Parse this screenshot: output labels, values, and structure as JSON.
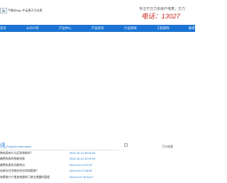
{
  "header": {
    "logo_text": "气象站logo 中云意万力仪表",
    "slogan": "专注于万力多用户电表，万力",
    "phone_label": "电话：",
    "phone_number": "13027"
  },
  "nav": {
    "items": [
      {
        "label": "首页"
      },
      {
        "label": "公司介绍"
      },
      {
        "label": "产品中心"
      },
      {
        "label": "产品资讯"
      },
      {
        "label": "行业新闻"
      },
      {
        "label": "工程案例"
      },
      {
        "label": "联系"
      }
    ]
  },
  "news": {
    "title": "讯",
    "subtitle": "Products information",
    "rows": [
      {
        "title": "物电表有什么区别和联系？",
        "date": "2024-10-14 18:16:18"
      },
      {
        "title": "缴费电表的智能电表",
        "date": "2024-10-14 12:09:04"
      },
      {
        "title": "缴费电表的功能特点",
        "date": "2024-9-8 11:37:43"
      },
      {
        "title": "电表在住宅物业的应用和管理？",
        "date": "2024-9-6 11:36:56"
      },
      {
        "title": "电费收户户更加快捷的门禁业便捷的管理",
        "date": "2024-6-20 15:30:17"
      }
    ]
  },
  "side_image": {
    "alt": "万力电表"
  }
}
